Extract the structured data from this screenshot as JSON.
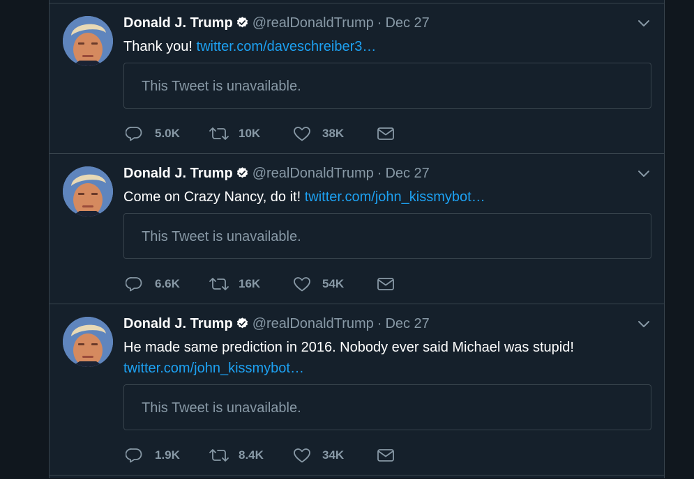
{
  "tweets": [
    {
      "name": "Donald J. Trump",
      "handle": "@realDonaldTrump",
      "separator": "·",
      "date": "Dec 27",
      "text": "Thank you!",
      "link": "twitter.com/daveschreiber3…",
      "quote": "This Tweet is unavailable.",
      "replies": "5.0K",
      "retweets": "10K",
      "likes": "38K"
    },
    {
      "name": "Donald J. Trump",
      "handle": "@realDonaldTrump",
      "separator": "·",
      "date": "Dec 27",
      "text": "Come on Crazy Nancy, do it!",
      "link": "twitter.com/john_kissmybot…",
      "quote": "This Tweet is unavailable.",
      "replies": "6.6K",
      "retweets": "16K",
      "likes": "54K"
    },
    {
      "name": "Donald J. Trump",
      "handle": "@realDonaldTrump",
      "separator": "·",
      "date": "Dec 27",
      "text": "He made same prediction in 2016. Nobody ever said Michael was stupid!",
      "link": "twitter.com/john_kissmybot…",
      "quote": "This Tweet is unavailable.",
      "replies": "1.9K",
      "retweets": "8.4K",
      "likes": "34K"
    }
  ],
  "icons": {
    "verified": "verified-badge-icon",
    "caret": "chevron-down-icon",
    "reply": "reply-icon",
    "retweet": "retweet-icon",
    "like": "heart-icon",
    "dm": "envelope-icon"
  },
  "colors": {
    "background": "#15202b",
    "outer": "#10171e",
    "border": "#38444d",
    "accent": "#1da1f2",
    "muted": "#8899a6"
  }
}
